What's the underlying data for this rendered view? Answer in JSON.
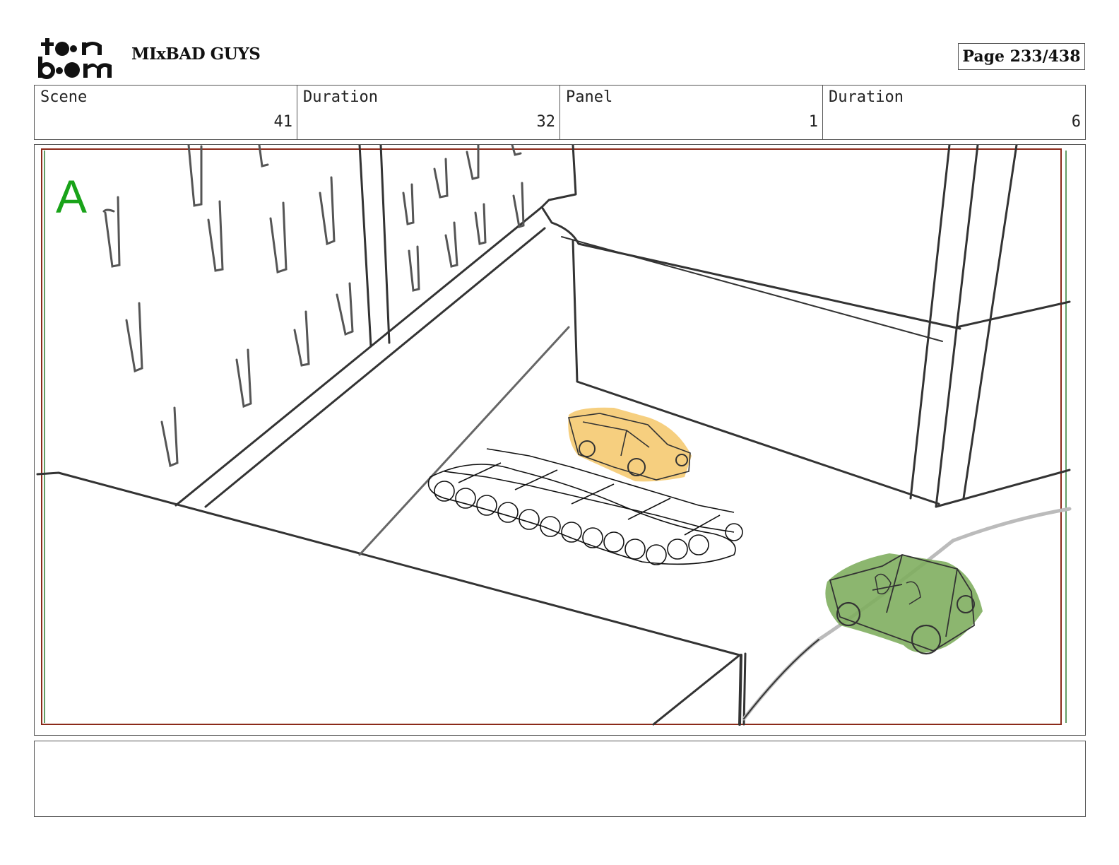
{
  "header": {
    "logo_top": "t●●n",
    "logo_bottom": "b●●m",
    "project_title": "MIxBAD GUYS",
    "page_label": "Page 233/438"
  },
  "info": {
    "scene_label": "Scene",
    "scene_value": "41",
    "scene_duration_label": "Duration",
    "scene_duration_value": "32",
    "panel_label": "Panel",
    "panel_value": "1",
    "panel_duration_label": "Duration",
    "panel_duration_value": "6"
  },
  "panel": {
    "layer_marker": "A",
    "colors": {
      "safe_frame_red": "#8b2a1a",
      "safe_frame_green": "#2e7d32",
      "marker_green": "#19a319",
      "car_yellow": "#f6cf7f",
      "car_green": "#7fae5f"
    }
  },
  "notes": {
    "text": ""
  }
}
